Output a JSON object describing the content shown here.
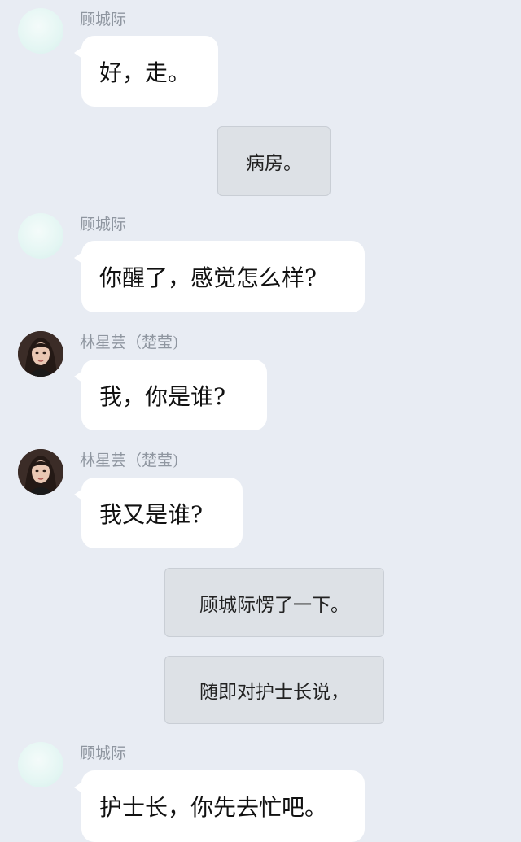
{
  "messages": [
    {
      "type": "chat",
      "sender": "顾城际",
      "avatar": "blank-avatar-icon",
      "text": "好，走。"
    },
    {
      "type": "narration",
      "text": "病房。"
    },
    {
      "type": "chat",
      "sender": "顾城际",
      "avatar": "blank-avatar-icon",
      "text": "你醒了，感觉怎么样?"
    },
    {
      "type": "chat",
      "sender": "林星芸（楚莹)",
      "avatar": "woman-portrait-icon",
      "text": "我，你是谁?"
    },
    {
      "type": "chat",
      "sender": "林星芸（楚莹)",
      "avatar": "woman-portrait-icon",
      "text": "我又是谁?"
    },
    {
      "type": "narration",
      "text": "顾城际愣了一下。"
    },
    {
      "type": "narration",
      "text": "随即对护士长说，"
    },
    {
      "type": "chat",
      "sender": "顾城际",
      "avatar": "blank-avatar-icon",
      "text": "护士长，你先去忙吧。"
    }
  ],
  "colors": {
    "background": "#e8ecf3",
    "bubble": "#ffffff",
    "narration_box": "#dde1e6",
    "sender_name": "#8f96a0"
  }
}
